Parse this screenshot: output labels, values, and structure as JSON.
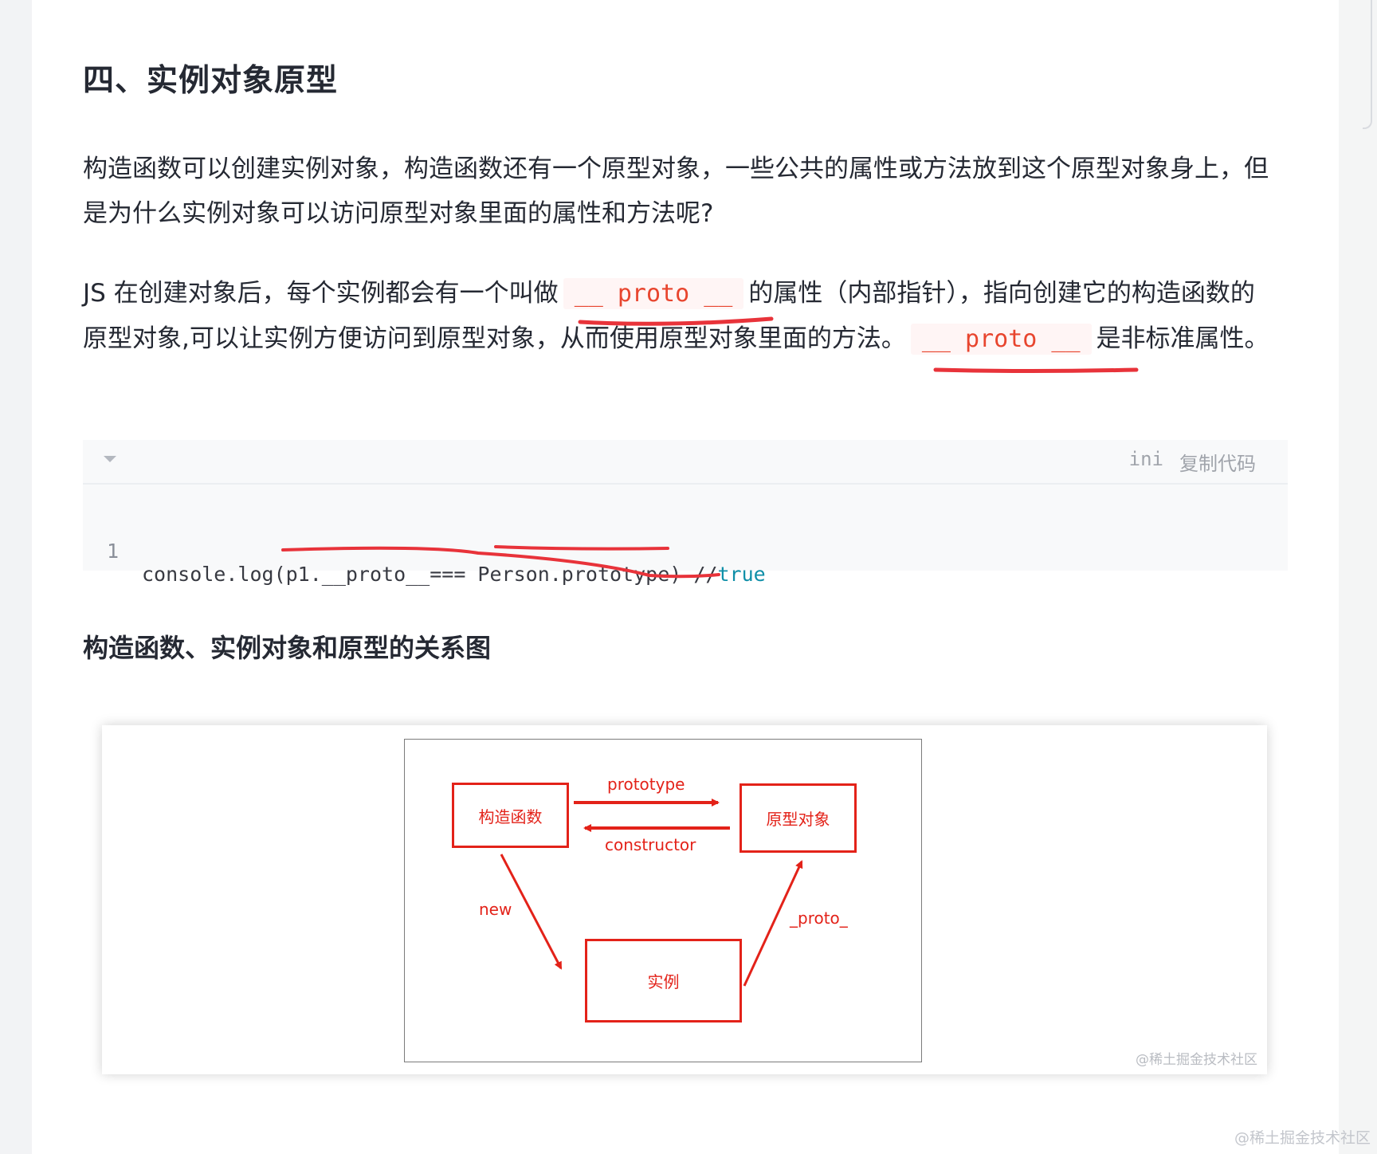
{
  "section": {
    "title": "四、实例对象原型"
  },
  "paragraph1": {
    "text": "构造函数可以创建实例对象，构造函数还有一个原型对象，一些公共的属性或方法放到这个原型对象身上，但是为什么实例对象可以访问原型对象里面的属性和方法呢?"
  },
  "paragraph2": {
    "part1": "JS 在创建对象后，每个实例都会有一个叫做",
    "code1": "__ proto __",
    "part2": "的属性（内部指针），指向创建它的构造函数的原型对象,可以让实例方便访问到原型对象，从而使用原型对象里面的方法。",
    "code2": "__ proto __",
    "part3": "是非标准属性。"
  },
  "code_block": {
    "language": "ini",
    "copy_label": "复制代码",
    "fold_icon": "chevron-down-icon",
    "lines": [
      {
        "number": "1",
        "before": "console.log(p1.__proto__=== Person.prototype) //",
        "keyword": "true"
      }
    ]
  },
  "subsection": {
    "title": "构造函数、实例对象和原型的关系图"
  },
  "diagram": {
    "nodes": {
      "constructor_fn": "构造函数",
      "prototype_obj": "原型对象",
      "instance": "实例"
    },
    "edges": {
      "prototype": "prototype",
      "constructor": "constructor",
      "new": "new",
      "proto": "_proto_"
    },
    "watermark": "@稀土掘金技术社区"
  },
  "page": {
    "watermark": "@稀土掘金技术社区"
  },
  "colors": {
    "accent_red": "#e32219",
    "inline_code": "#e8452e",
    "annotation": "#e8333a",
    "keyword": "#0f8fa8"
  }
}
